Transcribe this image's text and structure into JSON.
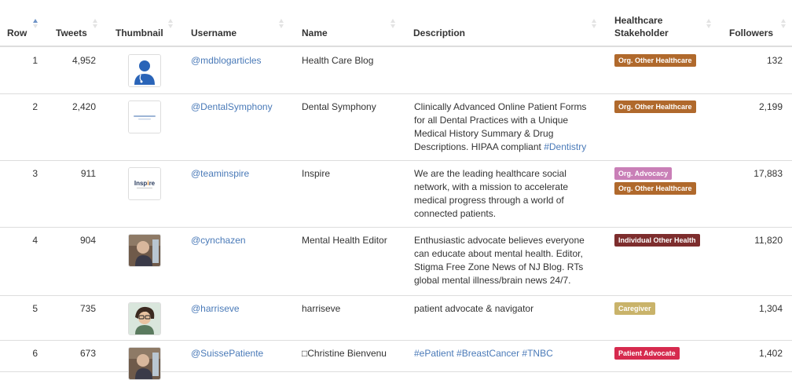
{
  "headers": {
    "row": "Row",
    "tweets": "Tweets",
    "thumbnail": "Thumbnail",
    "username": "Username",
    "name": "Name",
    "description": "Description",
    "stakeholder": "Healthcare Stakeholder",
    "followers": "Followers"
  },
  "badge_colors": {
    "Org. Other Healthcare": "#b0692c",
    "Org. Advocacy": "#c97fb7",
    "Individual Other Health": "#7d2d2d",
    "Caregiver": "#c9b36a",
    "Patient Advocate": "#d62a4e"
  },
  "rows": [
    {
      "row": "1",
      "tweets": "4,952",
      "thumbnail_icon": "blue-person-avatar",
      "username": "@mdblogarticles",
      "name": "Health Care Blog",
      "description": "",
      "hashtag": "",
      "badges": [
        "Org. Other Healthcare"
      ],
      "followers": "132"
    },
    {
      "row": "2",
      "tweets": "2,420",
      "thumbnail_icon": "dental-symphony-logo",
      "username": "@DentalSymphony",
      "name": "Dental Symphony",
      "description": "Clinically Advanced Online Patient Forms for all Dental Practices with a Unique Medical History Summary & Drug Descriptions. HIPAA compliant ",
      "hashtag": "#Dentistry",
      "badges": [
        "Org. Other Healthcare"
      ],
      "followers": "2,199"
    },
    {
      "row": "3",
      "tweets": "911",
      "thumbnail_icon": "inspire-logo",
      "username": "@teaminspire",
      "name": "Inspire",
      "description": "We are the leading healthcare social network, with a mission to accelerate medical progress through a world of connected patients.",
      "hashtag": "",
      "badges": [
        "Org. Advocacy",
        "Org. Other Healthcare"
      ],
      "followers": "17,883"
    },
    {
      "row": "4",
      "tweets": "904",
      "thumbnail_icon": "profile-photo",
      "username": "@cynchazen",
      "name": "Mental Health Editor",
      "description": "Enthusiastic advocate believes everyone can educate about mental health. Editor, Stigma Free Zone News of NJ Blog. RTs global mental illness/brain news 24/7.",
      "hashtag": "",
      "badges": [
        "Individual Other Health"
      ],
      "followers": "11,820"
    },
    {
      "row": "5",
      "tweets": "735",
      "thumbnail_icon": "cartoon-avatar",
      "username": "@harriseve",
      "name": "harriseve",
      "description": "patient advocate & navigator",
      "hashtag": "",
      "badges": [
        "Caregiver"
      ],
      "followers": "1,304"
    },
    {
      "row": "6",
      "tweets": "673",
      "thumbnail_icon": "profile-photo",
      "username": "@SuissePatiente",
      "name": "□Christine Bienvenu",
      "description": "",
      "hashtag": "#ePatient #BreastCancer #TNBC",
      "badges": [
        "Patient Advocate"
      ],
      "followers": "1,402"
    }
  ]
}
